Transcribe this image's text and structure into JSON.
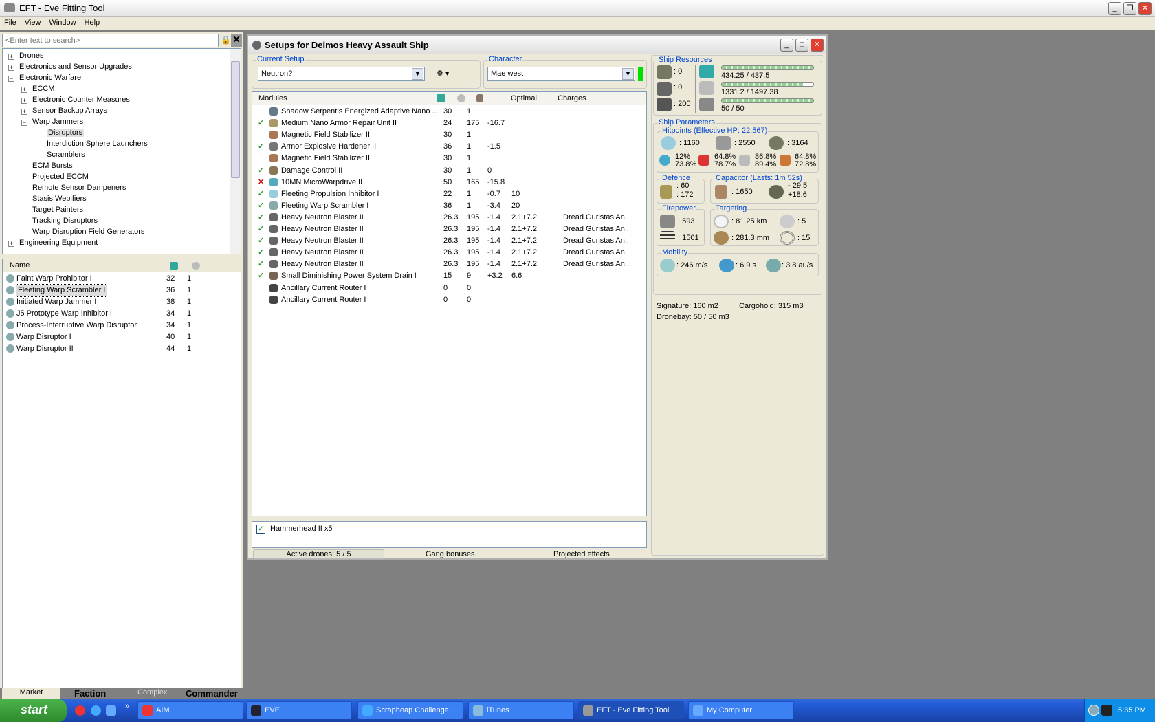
{
  "app": {
    "title": "EFT - Eve Fitting Tool",
    "menu": [
      "File",
      "View",
      "Window",
      "Help"
    ]
  },
  "left": {
    "search_placeholder": "<Enter text to search>",
    "tree": [
      {
        "label": "Drones",
        "level": 0,
        "toggle": "+"
      },
      {
        "label": "Electronics and Sensor Upgrades",
        "level": 0,
        "toggle": "+"
      },
      {
        "label": "Electronic Warfare",
        "level": 0,
        "toggle": "-"
      },
      {
        "label": "ECCM",
        "level": 1,
        "toggle": "+"
      },
      {
        "label": "Electronic Counter Measures",
        "level": 1,
        "toggle": "+"
      },
      {
        "label": "Sensor Backup Arrays",
        "level": 1,
        "toggle": "+"
      },
      {
        "label": "Warp Jammers",
        "level": 1,
        "toggle": "-"
      },
      {
        "label": "Disruptors",
        "level": 2,
        "toggle": "",
        "selected": true
      },
      {
        "label": "Interdiction Sphere Launchers",
        "level": 2,
        "toggle": ""
      },
      {
        "label": "Scramblers",
        "level": 2,
        "toggle": ""
      },
      {
        "label": "ECM Bursts",
        "level": 1,
        "toggle": ""
      },
      {
        "label": "Projected ECCM",
        "level": 1,
        "toggle": ""
      },
      {
        "label": "Remote Sensor Dampeners",
        "level": 1,
        "toggle": ""
      },
      {
        "label": "Stasis Webifiers",
        "level": 1,
        "toggle": ""
      },
      {
        "label": "Target Painters",
        "level": 1,
        "toggle": ""
      },
      {
        "label": "Tracking Disruptors",
        "level": 1,
        "toggle": ""
      },
      {
        "label": "Warp Disruption Field Generators",
        "level": 1,
        "toggle": ""
      },
      {
        "label": "Engineering Equipment",
        "level": 0,
        "toggle": "+"
      }
    ],
    "list_header": {
      "name": "Name"
    },
    "items": [
      {
        "name": "Faint Warp Prohibitor I",
        "cpu": "32",
        "pg": "1"
      },
      {
        "name": "Fleeting Warp Scrambler I",
        "cpu": "36",
        "pg": "1",
        "selected": true
      },
      {
        "name": "Initiated Warp Jammer I",
        "cpu": "38",
        "pg": "1"
      },
      {
        "name": "J5 Prototype Warp Inhibitor I",
        "cpu": "34",
        "pg": "1"
      },
      {
        "name": "Process-Interruptive Warp Disruptor",
        "cpu": "34",
        "pg": "1"
      },
      {
        "name": "Warp Disruptor I",
        "cpu": "40",
        "pg": "1"
      },
      {
        "name": "Warp Disruptor II",
        "cpu": "44",
        "pg": "1"
      }
    ],
    "tabs": [
      "Market",
      "Faction",
      "Complex",
      "Commander"
    ]
  },
  "setup": {
    "title": "Setups for Deimos Heavy Assault Ship",
    "current_setup_label": "Current Setup",
    "current_setup": "Neutron?",
    "character_label": "Character",
    "character": "Mae west",
    "columns": [
      "Modules",
      "",
      "",
      "",
      "Optimal",
      "Charges"
    ],
    "modules": [
      {
        "state": "",
        "name": "Shadow Serpentis Energized Adaptive Nano ...",
        "cpu": "30",
        "pg": "1",
        "cap": "",
        "optimal": "",
        "charges": ""
      },
      {
        "state": "on",
        "name": "Medium Nano Armor Repair Unit II",
        "cpu": "24",
        "pg": "175",
        "cap": "-16.7",
        "optimal": "",
        "charges": ""
      },
      {
        "state": "",
        "name": "Magnetic Field Stabilizer II",
        "cpu": "30",
        "pg": "1",
        "cap": "",
        "optimal": "",
        "charges": ""
      },
      {
        "state": "on",
        "name": "Armor Explosive Hardener II",
        "cpu": "36",
        "pg": "1",
        "cap": "-1.5",
        "optimal": "",
        "charges": ""
      },
      {
        "state": "",
        "name": "Magnetic Field Stabilizer II",
        "cpu": "30",
        "pg": "1",
        "cap": "",
        "optimal": "",
        "charges": ""
      },
      {
        "state": "on",
        "name": "Damage Control II",
        "cpu": "30",
        "pg": "1",
        "cap": "0",
        "optimal": "",
        "charges": ""
      },
      {
        "state": "off",
        "name": "10MN MicroWarpdrive II",
        "cpu": "50",
        "pg": "165",
        "cap": "-15.8",
        "optimal": "",
        "charges": ""
      },
      {
        "state": "on",
        "name": "Fleeting Propulsion Inhibitor I",
        "cpu": "22",
        "pg": "1",
        "cap": "-0.7",
        "optimal": "10",
        "charges": ""
      },
      {
        "state": "on",
        "name": "Fleeting Warp Scrambler I",
        "cpu": "36",
        "pg": "1",
        "cap": "-3.4",
        "optimal": "20",
        "charges": ""
      },
      {
        "state": "on",
        "name": "Heavy Neutron Blaster II",
        "cpu": "26.3",
        "pg": "195",
        "cap": "-1.4",
        "optimal": "2.1+7.2",
        "charges": "Dread Guristas An..."
      },
      {
        "state": "on",
        "name": "Heavy Neutron Blaster II",
        "cpu": "26.3",
        "pg": "195",
        "cap": "-1.4",
        "optimal": "2.1+7.2",
        "charges": "Dread Guristas An..."
      },
      {
        "state": "on",
        "name": "Heavy Neutron Blaster II",
        "cpu": "26.3",
        "pg": "195",
        "cap": "-1.4",
        "optimal": "2.1+7.2",
        "charges": "Dread Guristas An..."
      },
      {
        "state": "on",
        "name": "Heavy Neutron Blaster II",
        "cpu": "26.3",
        "pg": "195",
        "cap": "-1.4",
        "optimal": "2.1+7.2",
        "charges": "Dread Guristas An..."
      },
      {
        "state": "on",
        "name": "Heavy Neutron Blaster II",
        "cpu": "26.3",
        "pg": "195",
        "cap": "-1.4",
        "optimal": "2.1+7.2",
        "charges": "Dread Guristas An..."
      },
      {
        "state": "on",
        "name": "Small Diminishing Power System Drain I",
        "cpu": "15",
        "pg": "9",
        "cap": "+3.2",
        "optimal": "6.6",
        "charges": ""
      },
      {
        "state": "",
        "name": "Ancillary Current Router I",
        "cpu": "0",
        "pg": "0",
        "cap": "",
        "optimal": "",
        "charges": ""
      },
      {
        "state": "",
        "name": "Ancillary Current Router I",
        "cpu": "0",
        "pg": "0",
        "cap": "",
        "optimal": "",
        "charges": ""
      }
    ],
    "drones": [
      {
        "label": "Hammerhead II x5",
        "checked": true
      }
    ],
    "bottom_tabs": [
      "Active drones: 5 / 5",
      "Gang bonuses",
      "Projected effects"
    ]
  },
  "stats": {
    "resources_label": "Ship Resources",
    "turret": ": 0",
    "launcher": ": 0",
    "calibration": ": 200",
    "cpu": "434.25 / 437.5",
    "cpu_fill": 0.992,
    "powergrid": "1331.2 / 1497.38",
    "pg_fill": 0.889,
    "drone_bw": "50 / 50",
    "bw_fill": 1.0,
    "params_label": "Ship Parameters",
    "hitpoints_label": "Hitpoints (Effective HP: 22,567)",
    "shield": ": 1160",
    "armor": ": 2550",
    "structure": ": 3164",
    "resists": [
      {
        "a": "12%",
        "b": "73.8%"
      },
      {
        "a": "64.8%",
        "b": "78.7%"
      },
      {
        "a": "86.8%",
        "b": "89.4%"
      },
      {
        "a": "64.8%",
        "b": "72.8%"
      }
    ],
    "defence_label": "Defence",
    "def_a": ": 60",
    "def_b": ": 172",
    "capacitor_label": "Capacitor (Lasts: 1m 52s)",
    "cap_amount": ": 1650",
    "cap_use": "- 29.5",
    "cap_recharge": "+18.6",
    "firepower_label": "Firepower",
    "dps": ": 593",
    "volley": ": 1501",
    "targeting_label": "Targeting",
    "range": ": 81.25 km",
    "targets": ": 5",
    "scan_res": ": 281.3 mm",
    "sensor": ": 15",
    "mobility_label": "Mobility",
    "speed": ": 246 m/s",
    "align": ": 6.9 s",
    "warp": ": 3.8 au/s",
    "signature": "Signature: 160 m2",
    "cargo": "Cargohold: 315 m3",
    "dronebay": "Dronebay: 50 / 50 m3"
  },
  "taskbar": {
    "start": "start",
    "tasks": [
      "AIM",
      "EVE",
      "Scrapheap Challenge ...",
      "iTunes",
      "EFT - Eve Fitting Tool",
      "My Computer"
    ],
    "active": 4,
    "clock": "5:35 PM"
  },
  "colors": {
    "accent": "#0046d5",
    "check": "#2e9a2e",
    "offline": "#d01010",
    "character_status": "#00e000"
  }
}
